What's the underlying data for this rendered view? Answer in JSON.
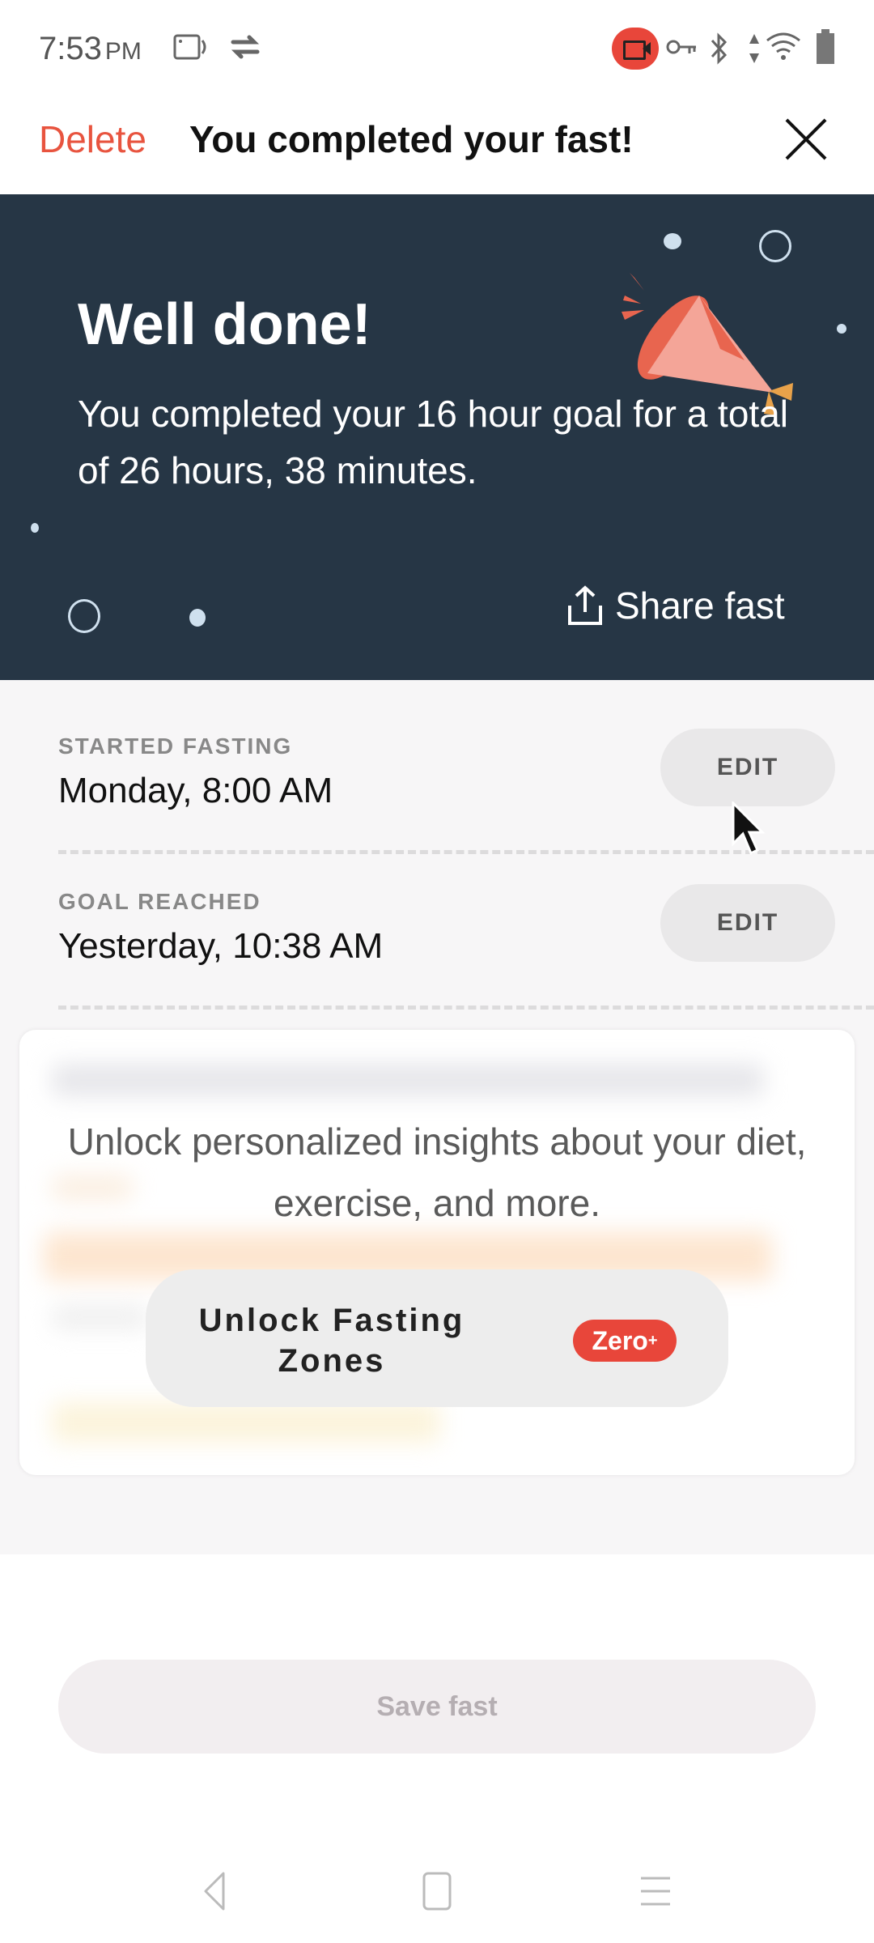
{
  "status_bar": {
    "time": "7:53",
    "ampm": "PM",
    "left_icons": [
      "screen-record-icon",
      "sync-icon"
    ],
    "right_icons": [
      "recording-indicator-icon",
      "vpn-key-icon",
      "bluetooth-icon",
      "data-arrows-icon",
      "wifi-icon",
      "battery-icon"
    ]
  },
  "header": {
    "delete_label": "Delete",
    "title": "You completed your fast!",
    "close_icon": "close-icon"
  },
  "banner": {
    "title": "Well done!",
    "message": "You completed your 16 hour goal for a total of 26 hours, 38 minutes.",
    "share_label": "Share fast",
    "illustration": "party-popper-icon",
    "colors": {
      "background": "#263645",
      "accent": "#e8654f"
    }
  },
  "details": {
    "started": {
      "label": "STARTED FASTING",
      "value": "Monday, 8:00 AM",
      "edit_label": "EDIT"
    },
    "goal": {
      "label": "GOAL REACHED",
      "value": "Yesterday, 10:38 AM",
      "edit_label": "EDIT"
    }
  },
  "upsell": {
    "text": "Unlock personalized insights about your diet, exercise, and more.",
    "button_label": "Unlock Fasting Zones",
    "badge": "Zero",
    "badge_sup": "+",
    "badge_color": "#e8463a"
  },
  "footer": {
    "save_label": "Save fast"
  },
  "nav": {
    "buttons": [
      "back-icon",
      "home-icon",
      "recents-icon"
    ]
  }
}
